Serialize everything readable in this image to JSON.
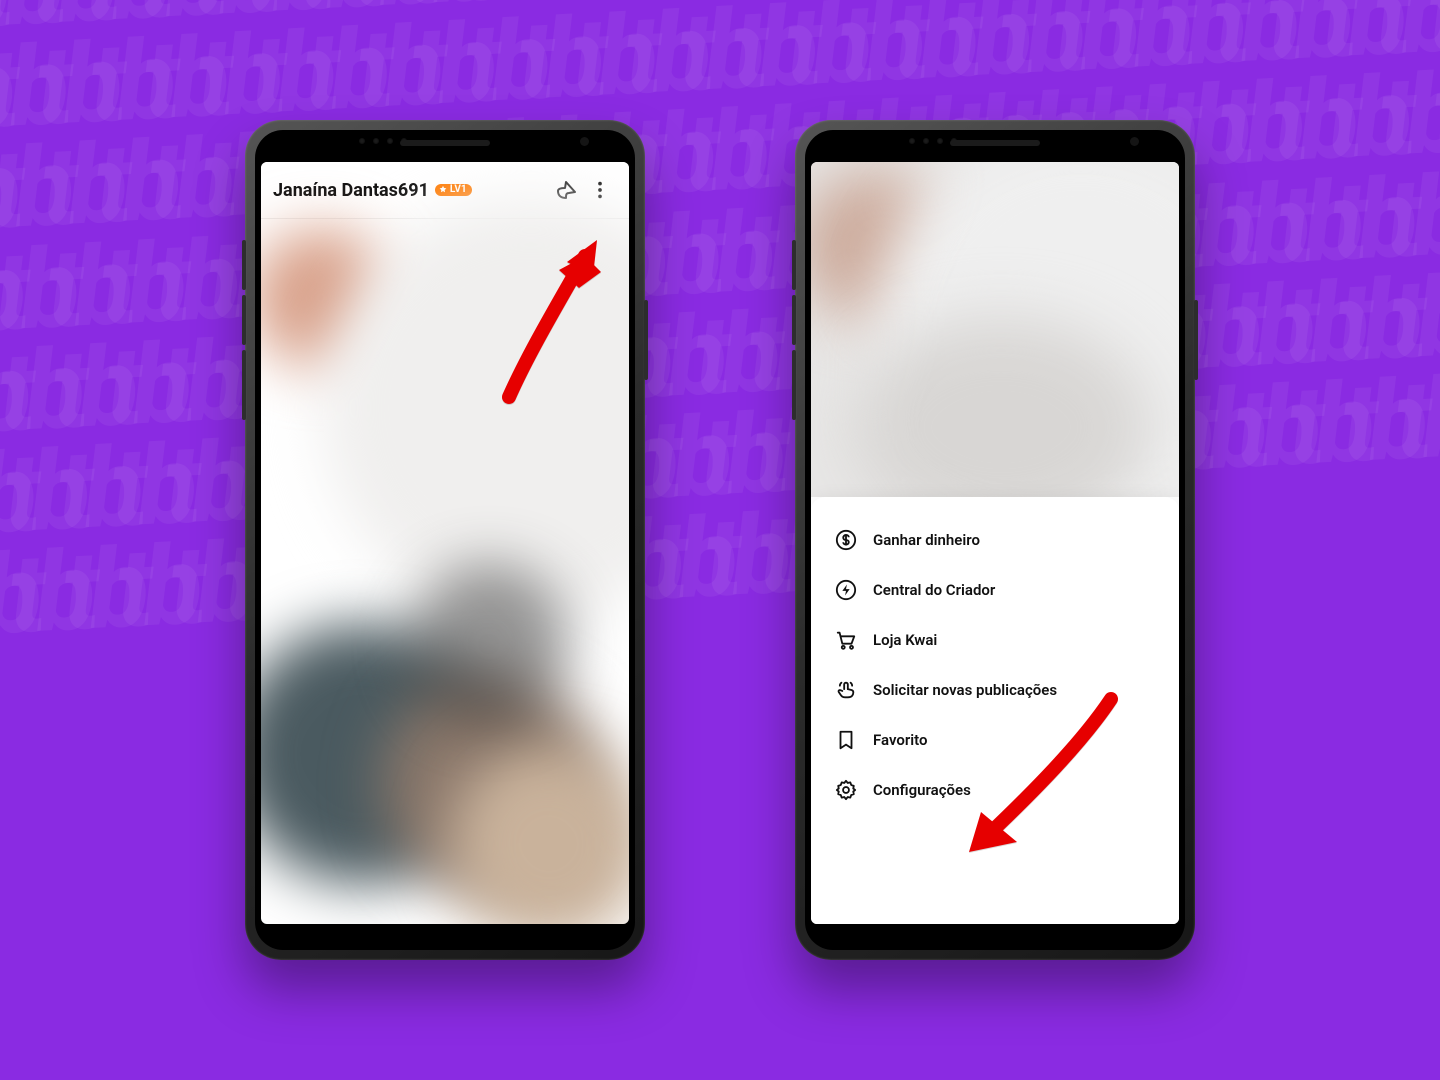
{
  "background": {
    "color": "#8a2be2",
    "watermark_text": "tb"
  },
  "left_phone": {
    "header": {
      "username": "Janaína Dantas691",
      "badge_text": "LV1",
      "share_icon": "share-icon",
      "menu_icon": "more-vertical-icon"
    }
  },
  "right_phone": {
    "menu_items": [
      {
        "icon": "dollar-icon",
        "label": "Ganhar dinheiro"
      },
      {
        "icon": "bolt-icon",
        "label": "Central do Criador"
      },
      {
        "icon": "cart-icon",
        "label": "Loja Kwai"
      },
      {
        "icon": "tap-icon",
        "label": "Solicitar novas publicações"
      },
      {
        "icon": "bookmark-icon",
        "label": "Favorito"
      },
      {
        "icon": "gear-icon",
        "label": "Configurações"
      }
    ]
  },
  "annotations": {
    "arrow_left_target": "more-vertical-icon",
    "arrow_right_target": "menu-item-configuracoes"
  },
  "colors": {
    "accent_orange": "#ff7a00",
    "annotation_red": "#e60000"
  }
}
